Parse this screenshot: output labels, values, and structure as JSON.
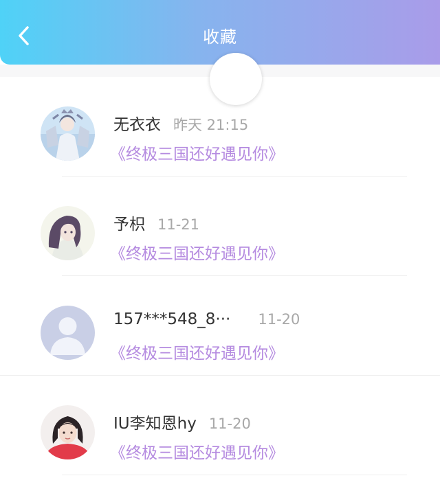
{
  "header": {
    "title": "收藏",
    "back_icon": "chevron-left-icon",
    "gradient": [
      "#4fd2f7",
      "#a99ce9"
    ]
  },
  "accent_color": "#b58be0",
  "items": [
    {
      "name": "无衣衣",
      "time": "昨天 21:15",
      "book": "《终极三国还好遇见你》",
      "avatar": "anime-character-avatar"
    },
    {
      "name": "予枳",
      "time": "11-21",
      "book": "《终极三国还好遇见你》",
      "avatar": "anime-girl-avatar"
    },
    {
      "name": "157***548_8···",
      "time": "11-20",
      "book": "《终极三国还好遇见你》",
      "avatar": "default-user-avatar"
    },
    {
      "name": "IU李知恩hy",
      "time": "11-20",
      "book": "《终极三国还好遇见你》",
      "avatar": "photo-avatar"
    }
  ]
}
